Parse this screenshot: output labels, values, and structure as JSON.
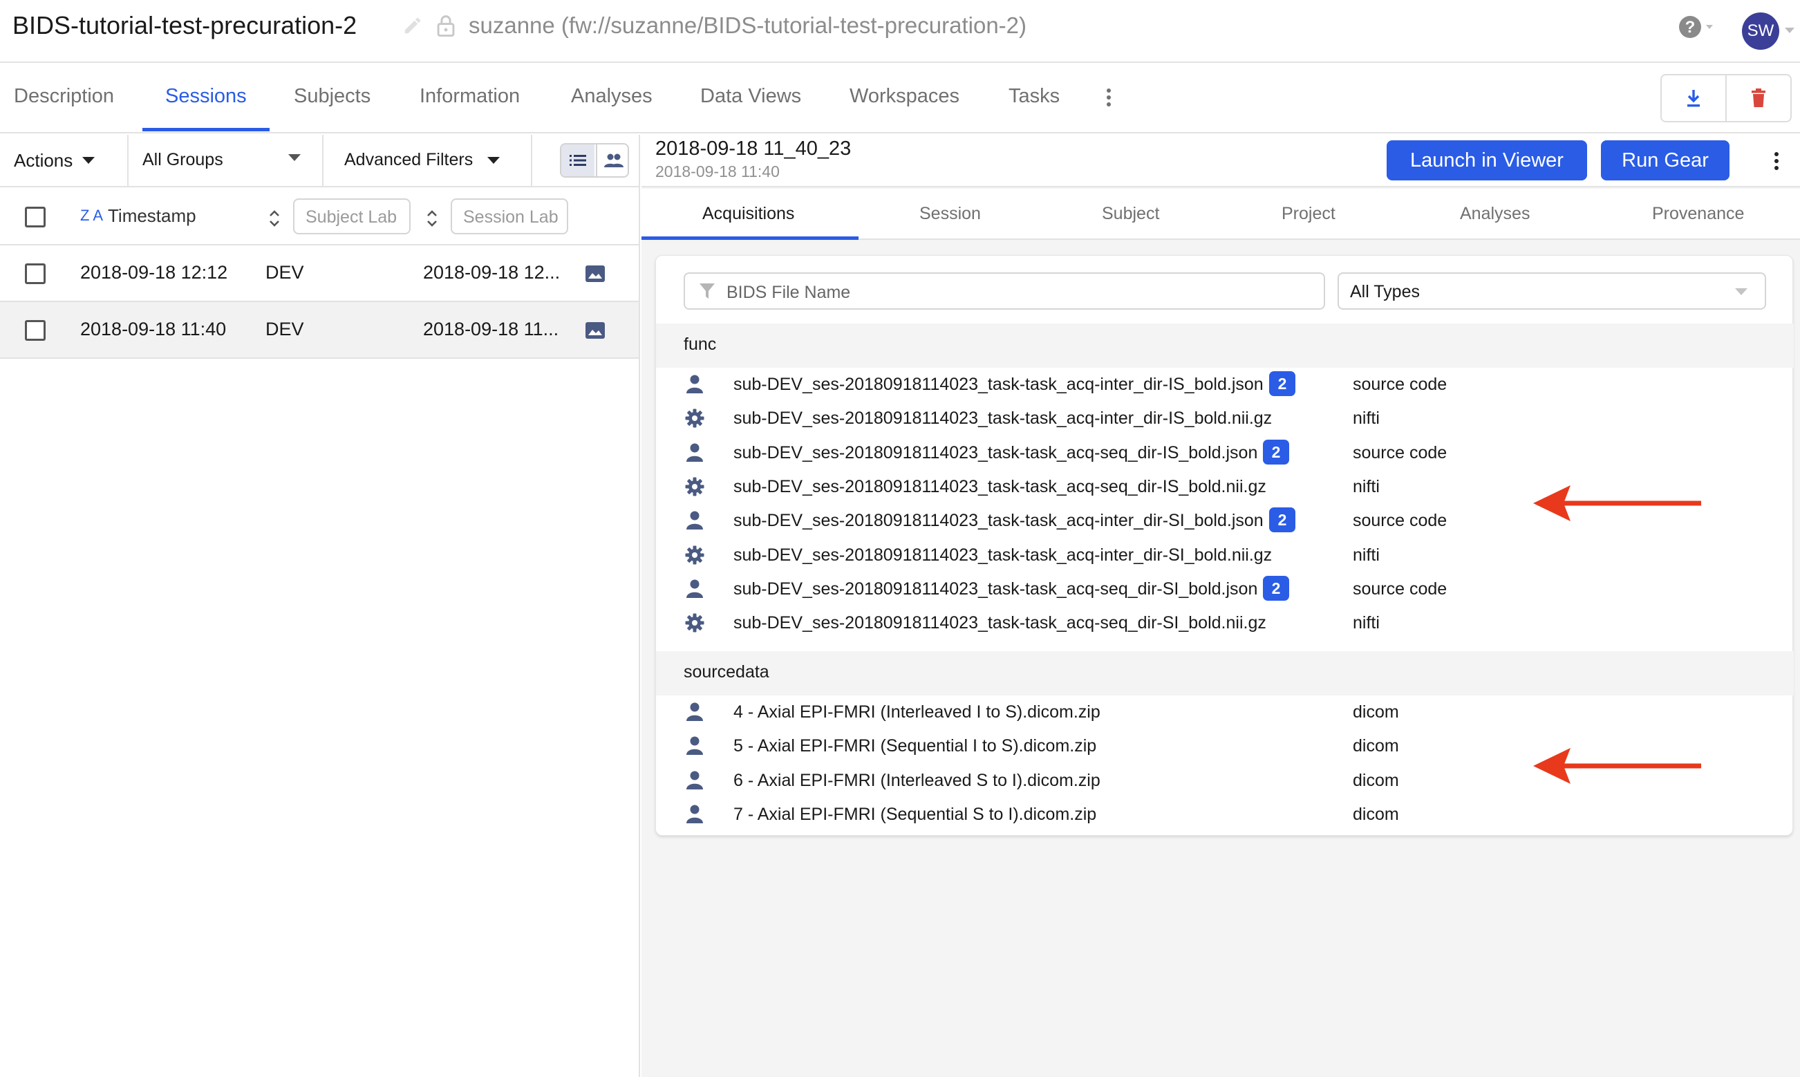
{
  "header": {
    "project_title": "BIDS-tutorial-test-precuration-2",
    "project_path": "suzanne (fw://suzanne/BIDS-tutorial-test-precuration-2)",
    "avatar_initials": "SW"
  },
  "tabs": [
    {
      "label": "Description"
    },
    {
      "label": "Sessions",
      "active": true
    },
    {
      "label": "Subjects"
    },
    {
      "label": "Information"
    },
    {
      "label": "Analyses"
    },
    {
      "label": "Data Views"
    },
    {
      "label": "Workspaces"
    },
    {
      "label": "Tasks"
    }
  ],
  "filters": {
    "actions": "Actions",
    "groups": "All Groups",
    "advanced": "Advanced Filters"
  },
  "list_header": {
    "sort_indicator": "Z A",
    "timestamp": "Timestamp",
    "subject_placeholder": "Subject Lab",
    "session_placeholder": "Session Lab"
  },
  "sessions": [
    {
      "timestamp": "2018-09-18 12:12",
      "subject": "DEV",
      "session": "2018-09-18 12..."
    },
    {
      "timestamp": "2018-09-18 11:40",
      "subject": "DEV",
      "session": "2018-09-18 11..."
    }
  ],
  "session_panel": {
    "title": "2018-09-18 11_40_23",
    "subtitle": "2018-09-18 11:40",
    "launch_label": "Launch in Viewer",
    "run_gear_label": "Run Gear"
  },
  "subtabs": [
    {
      "label": "Acquisitions",
      "active": true
    },
    {
      "label": "Session"
    },
    {
      "label": "Subject"
    },
    {
      "label": "Project"
    },
    {
      "label": "Analyses"
    },
    {
      "label": "Provenance"
    }
  ],
  "file_filter": {
    "placeholder": "BIDS File Name",
    "type_select": "All Types"
  },
  "groups": [
    {
      "label": "func",
      "files": [
        {
          "icon": "user-icon",
          "name": "sub-DEV_ses-20180918114023_task-task_acq-inter_dir-IS_bold.json",
          "badge": "2",
          "type": "source code"
        },
        {
          "icon": "gear-icon",
          "name": "sub-DEV_ses-20180918114023_task-task_acq-inter_dir-IS_bold.nii.gz",
          "badge": "",
          "type": "nifti"
        },
        {
          "icon": "user-icon",
          "name": "sub-DEV_ses-20180918114023_task-task_acq-seq_dir-IS_bold.json",
          "badge": "2",
          "type": "source code"
        },
        {
          "icon": "gear-icon",
          "name": "sub-DEV_ses-20180918114023_task-task_acq-seq_dir-IS_bold.nii.gz",
          "badge": "",
          "type": "nifti"
        },
        {
          "icon": "user-icon",
          "name": "sub-DEV_ses-20180918114023_task-task_acq-inter_dir-SI_bold.json",
          "badge": "2",
          "type": "source code"
        },
        {
          "icon": "gear-icon",
          "name": "sub-DEV_ses-20180918114023_task-task_acq-inter_dir-SI_bold.nii.gz",
          "badge": "",
          "type": "nifti"
        },
        {
          "icon": "user-icon",
          "name": "sub-DEV_ses-20180918114023_task-task_acq-seq_dir-SI_bold.json",
          "badge": "2",
          "type": "source code"
        },
        {
          "icon": "gear-icon",
          "name": "sub-DEV_ses-20180918114023_task-task_acq-seq_dir-SI_bold.nii.gz",
          "badge": "",
          "type": "nifti"
        }
      ]
    },
    {
      "label": "sourcedata",
      "files": [
        {
          "icon": "user-icon",
          "name": "4 - Axial EPI-FMRI (Interleaved I to S).dicom.zip",
          "badge": "",
          "type": "dicom"
        },
        {
          "icon": "user-icon",
          "name": "5 - Axial EPI-FMRI (Sequential I to S).dicom.zip",
          "badge": "",
          "type": "dicom"
        },
        {
          "icon": "user-icon",
          "name": "6 - Axial EPI-FMRI (Interleaved S to I).dicom.zip",
          "badge": "",
          "type": "dicom"
        },
        {
          "icon": "user-icon",
          "name": "7 - Axial EPI-FMRI (Sequential S to I).dicom.zip",
          "badge": "",
          "type": "dicom"
        }
      ]
    }
  ],
  "colors": {
    "accent": "#2a5ce6",
    "icon": "#4a5a82",
    "delete": "#d9463b",
    "annotation_arrow": "#e8391c",
    "avatar": "#3b3f98"
  }
}
